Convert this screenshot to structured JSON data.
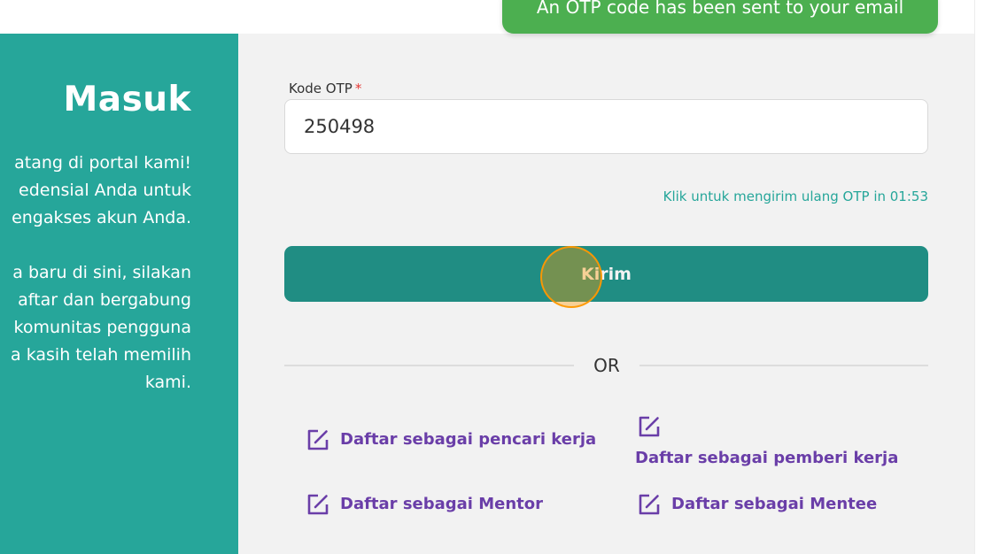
{
  "toast": {
    "message": "An OTP code has been sent to your email"
  },
  "left_panel": {
    "title": "Masuk",
    "paragraph1_lines": [
      "atang di portal kami!",
      "edensial Anda untuk",
      "engakses akun Anda."
    ],
    "paragraph2_lines": [
      "a baru di sini, silakan",
      "aftar dan bergabung",
      "komunitas pengguna",
      "a kasih telah memilih",
      "kami."
    ]
  },
  "form": {
    "otp_label": "Kode OTP",
    "required_mark": "*",
    "otp_value": "250498",
    "resend_text": "Klik untuk mengirim ulang OTP in 01:53",
    "submit_label": "Kirim",
    "divider_text": "OR"
  },
  "register_links": {
    "job_seeker": "Daftar sebagai pencari kerja",
    "employer": "Daftar sebagai pemberi kerja",
    "mentor": "Daftar sebagai Mentor",
    "mentee": "Daftar sebagai Mentee"
  },
  "icons": {
    "register": "edit-square-icon"
  },
  "colors": {
    "primary": "#26a69a",
    "button": "#208d83",
    "link": "#6a3ea8",
    "toast": "#4caf50",
    "required": "#e53935"
  }
}
